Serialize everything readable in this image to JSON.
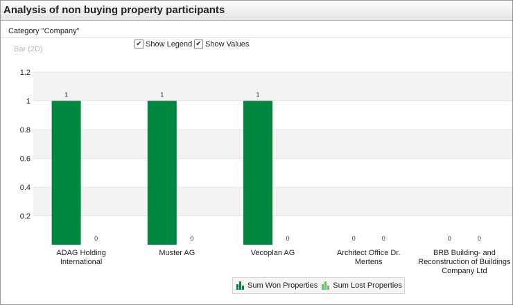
{
  "window": {
    "title": "Analysis of non buying property participants"
  },
  "category_label": "Category \"Company\"",
  "options": [
    {
      "label": "Show Legend",
      "checked": true
    },
    {
      "label": "Show Values",
      "checked": true
    }
  ],
  "chart_type_label": "Bar (2D)",
  "legend": {
    "items": [
      {
        "label": "Sum Won Properties",
        "color": "#00873f"
      },
      {
        "label": "Sum Lost Properties",
        "color": "#6fc06a"
      }
    ]
  },
  "chart_data": {
    "type": "bar",
    "categories": [
      [
        "ADAG Holding",
        "International"
      ],
      [
        "Muster AG"
      ],
      [
        "Vecoplan AG"
      ],
      [
        "Architect Office Dr.",
        "Mertens"
      ],
      [
        "BRB Building- and",
        "Reconstruction of Buildings",
        "Company Ltd"
      ]
    ],
    "series": [
      {
        "name": "Sum Won Properties",
        "values": [
          1,
          1,
          1,
          0,
          0
        ],
        "color": "#00873f"
      },
      {
        "name": "Sum Lost Properties",
        "values": [
          0,
          0,
          0,
          0,
          0
        ],
        "color": "#6fc06a"
      }
    ],
    "ylim": [
      0,
      1.2
    ],
    "yticks": [
      0.2,
      0.4,
      0.6,
      0.8,
      1,
      1.2
    ],
    "show_values": true,
    "grid": "alternating bands"
  }
}
